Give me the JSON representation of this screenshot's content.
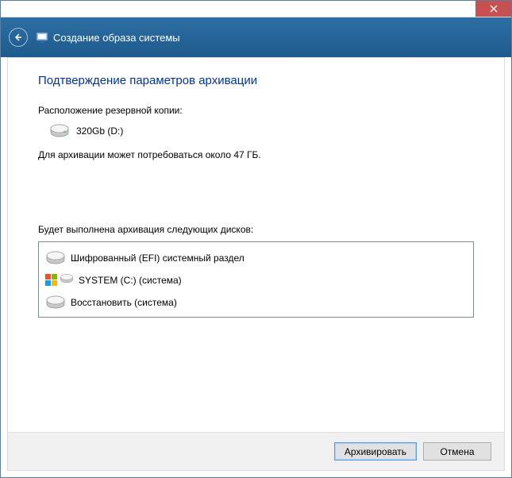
{
  "header": {
    "title": "Создание образа системы"
  },
  "page": {
    "title": "Подтверждение параметров архивации",
    "backup_location_label": "Расположение резервной копии:",
    "destination": "320Gb (D:)",
    "space_info": "Для архивации может потребоваться около 47 ГБ.",
    "disks_label": "Будет выполнена архивация следующих дисков:"
  },
  "disks": [
    {
      "label": "Шифрованный (EFI) системный раздел",
      "icon": "drive"
    },
    {
      "label": "SYSTEM (C:) (система)",
      "icon": "windows-drive"
    },
    {
      "label": "Восстановить (система)",
      "icon": "drive"
    }
  ],
  "buttons": {
    "archive": "Архивировать",
    "cancel": "Отмена"
  }
}
